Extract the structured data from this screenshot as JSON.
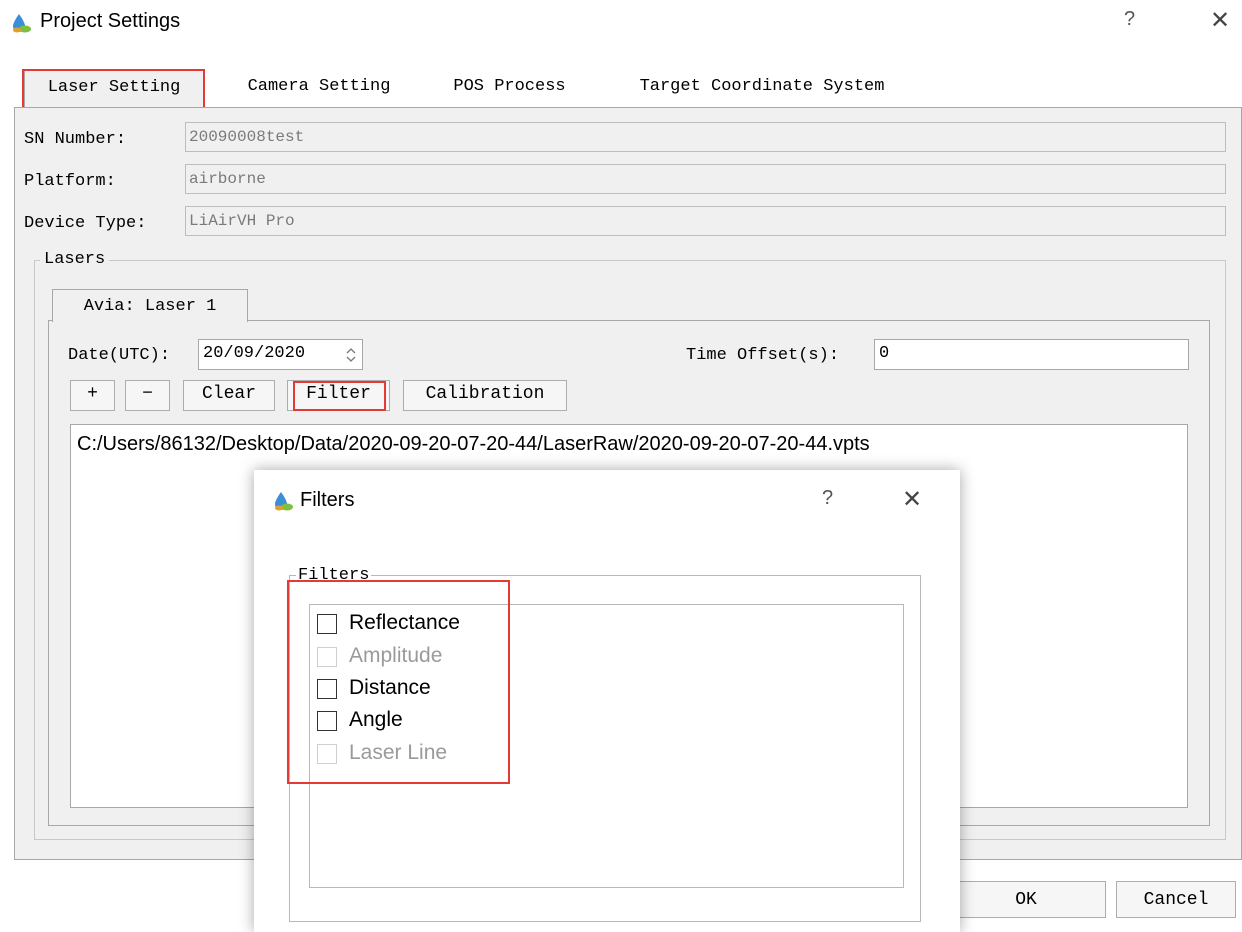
{
  "window": {
    "title": "Project Settings",
    "help_symbol": "?",
    "close_symbol": "✕"
  },
  "tabs": [
    {
      "label": "Laser Setting"
    },
    {
      "label": "Camera Setting"
    },
    {
      "label": "POS Process"
    },
    {
      "label": "Target Coordinate System"
    }
  ],
  "fields": {
    "sn_label": "SN Number:",
    "sn_value": "20090008test",
    "platform_label": "Platform:",
    "platform_value": "airborne",
    "device_label": "Device Type:",
    "device_value": "LiAirVH Pro"
  },
  "lasers": {
    "group_title": "Lasers",
    "tab_label": "Avia: Laser 1",
    "date_label": "Date(UTC):",
    "date_value": "20/09/2020",
    "time_offset_label": "Time Offset(s):",
    "time_offset_value": "0",
    "buttons": {
      "add": "+",
      "remove": "−",
      "clear": "Clear",
      "filter": "Filter",
      "calibration": "Calibration"
    },
    "files": [
      "C:/Users/86132/Desktop/Data/2020-09-20-07-20-44/LaserRaw/2020-09-20-07-20-44.vpts"
    ]
  },
  "footer": {
    "ok": "OK",
    "cancel": "Cancel"
  },
  "filters_dialog": {
    "title": "Filters",
    "help_symbol": "?",
    "close_symbol": "✕",
    "group_title": "Filters",
    "options": [
      {
        "label": "Reflectance",
        "checked": false,
        "enabled": true
      },
      {
        "label": "Amplitude",
        "checked": false,
        "enabled": false
      },
      {
        "label": "Distance",
        "checked": false,
        "enabled": true
      },
      {
        "label": "Angle",
        "checked": false,
        "enabled": true
      },
      {
        "label": "Laser Line",
        "checked": false,
        "enabled": false
      }
    ]
  },
  "colors": {
    "highlight": "#e53935",
    "panel": "#f0f0f0",
    "disabled_text": "#9a9a9a"
  },
  "icons": {
    "app": "water-drop-app-icon",
    "help": "question-mark-icon",
    "close": "close-icon",
    "spin": "spin-arrows-icon"
  }
}
